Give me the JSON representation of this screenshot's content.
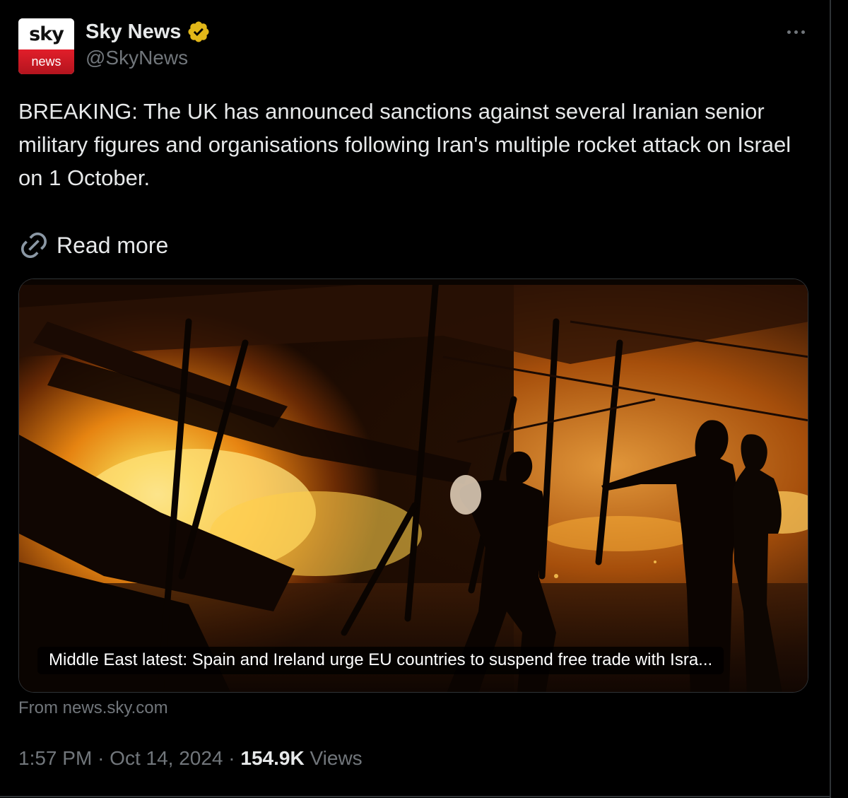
{
  "author": {
    "display_name": "Sky News",
    "handle": "@SkyNews",
    "avatar_top_text": "sky",
    "avatar_bottom_text": "news",
    "verified_badge_color": "#e2b719"
  },
  "menu": {
    "icon": "more-dots-icon"
  },
  "tweet": {
    "text": "BREAKING: The UK has announced sanctions against several Iranian senior military figures and organisations following Iran's multiple rocket attack on Israel on 1 October.",
    "read_more_label": "Read more",
    "read_more_icon": "link-icon"
  },
  "card": {
    "caption": "Middle East latest: Spain and Ireland urge EU countries to suspend free trade with Isra...",
    "image_subject": "fire-scene-photo",
    "source": "From news.sky.com"
  },
  "meta": {
    "time": "1:57 PM",
    "separator": "·",
    "date": "Oct 14, 2024",
    "views_count": "154.9K",
    "views_label": "Views"
  },
  "colors": {
    "background": "#000000",
    "primary_text": "#e7e9ea",
    "secondary_text": "#71767b",
    "border": "#2f3336",
    "sky_red": "#e21e2a"
  }
}
